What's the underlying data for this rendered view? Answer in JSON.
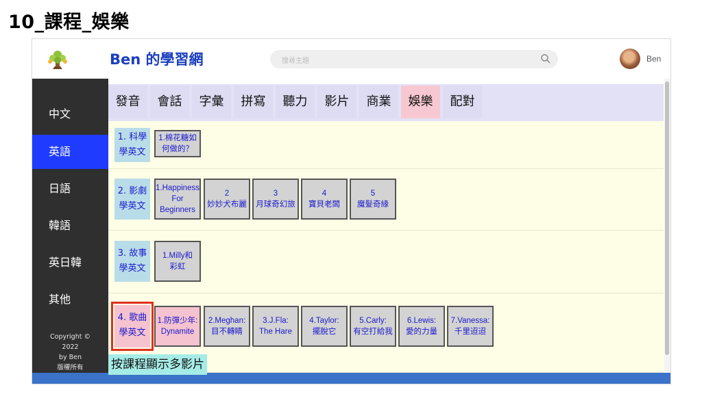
{
  "slide_title": "10_課程_娛樂",
  "header": {
    "brand": "Ben 的學習網",
    "search_placeholder": "搜尋主題",
    "user_name": "Ben"
  },
  "sidebar": {
    "items": [
      {
        "label": "中文",
        "active": false
      },
      {
        "label": "英語",
        "active": true
      },
      {
        "label": "日語",
        "active": false
      },
      {
        "label": "韓語",
        "active": false
      },
      {
        "label": "英日韓",
        "active": false
      },
      {
        "label": "其他",
        "active": false
      }
    ],
    "copyright": [
      "Copyright ©",
      "2022",
      "by Ben",
      "版權所有"
    ]
  },
  "tabs": [
    "發音",
    "會話",
    "字彙",
    "拼寫",
    "聽力",
    "影片",
    "商業",
    "娛樂",
    "配對"
  ],
  "active_tab": "娛樂",
  "courses": [
    {
      "label": "1. 科學\n學英文",
      "videos": [
        "1.棉花糖如\n何做的？"
      ]
    },
    {
      "label": "2. 影劇\n學英文",
      "videos": [
        "1.Happiness\nFor\nBeginners",
        "2\n妙妙犬布麗",
        "3\n月球奇幻旅",
        "4\n寶貝老闆",
        "5\n魔髮奇緣"
      ]
    },
    {
      "label": "3. 故事\n學英文",
      "videos": [
        "1.Milly和\n彩虹"
      ]
    },
    {
      "label": "4. 歌曲\n學英文",
      "videos": [
        "1.防彈少年:\nDynamite",
        "2.Meghan:\n目不轉睛",
        "3.J.Fla:\nThe Hare",
        "4.Taylor:\n擺脫它",
        "5.Carly:\n有空打給我",
        "6.Lewis:\n愛的力量",
        "7.Vanessa:\n千里迢迢"
      ]
    }
  ],
  "caption": "按課程顯示多影片",
  "colors": {
    "brand": "#1b3fbf",
    "sidebar_bg": "#2f2f2f",
    "sidebar_active": "#1f3bff",
    "tab_bg": "#dedcf2",
    "tab_active": "#f7c8d2",
    "section_bg": "#fefee6",
    "label_blue": "#b9dde8",
    "label_pink": "#f5c2cf",
    "highlight": "#e0301e",
    "caption_bg": "#a6ece6"
  }
}
